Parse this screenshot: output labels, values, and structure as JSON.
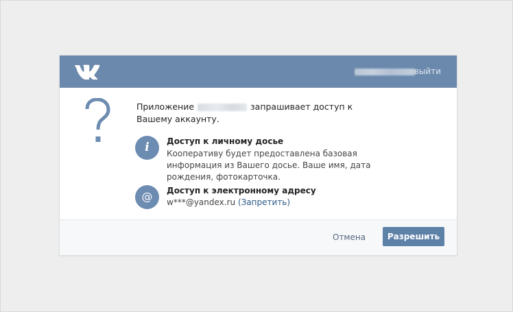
{
  "header": {
    "logo": "vk-logo",
    "logout_label": "выйти"
  },
  "request": {
    "prefix": "Приложение",
    "suffix": "запрашивает доступ к Вашему аккаунту."
  },
  "permissions": [
    {
      "icon": "info-icon",
      "icon_glyph": "i",
      "title": "Доступ к личному досье",
      "description": "Кооперативу будет предоставлена базовая информация из Вашего досье. Ваше имя, дата рождения, фотокарточка."
    },
    {
      "icon": "at-icon",
      "icon_glyph": "@",
      "title": "Доступ к электронному адресу",
      "description": "w***@yandex.ru",
      "action_label": "(Запретить)"
    }
  ],
  "footer": {
    "cancel_label": "Отмена",
    "allow_label": "Разрешить"
  },
  "colors": {
    "header_bg": "#6b89ac",
    "accent": "#5e81a8",
    "icon_bg": "#6d8cb1"
  }
}
